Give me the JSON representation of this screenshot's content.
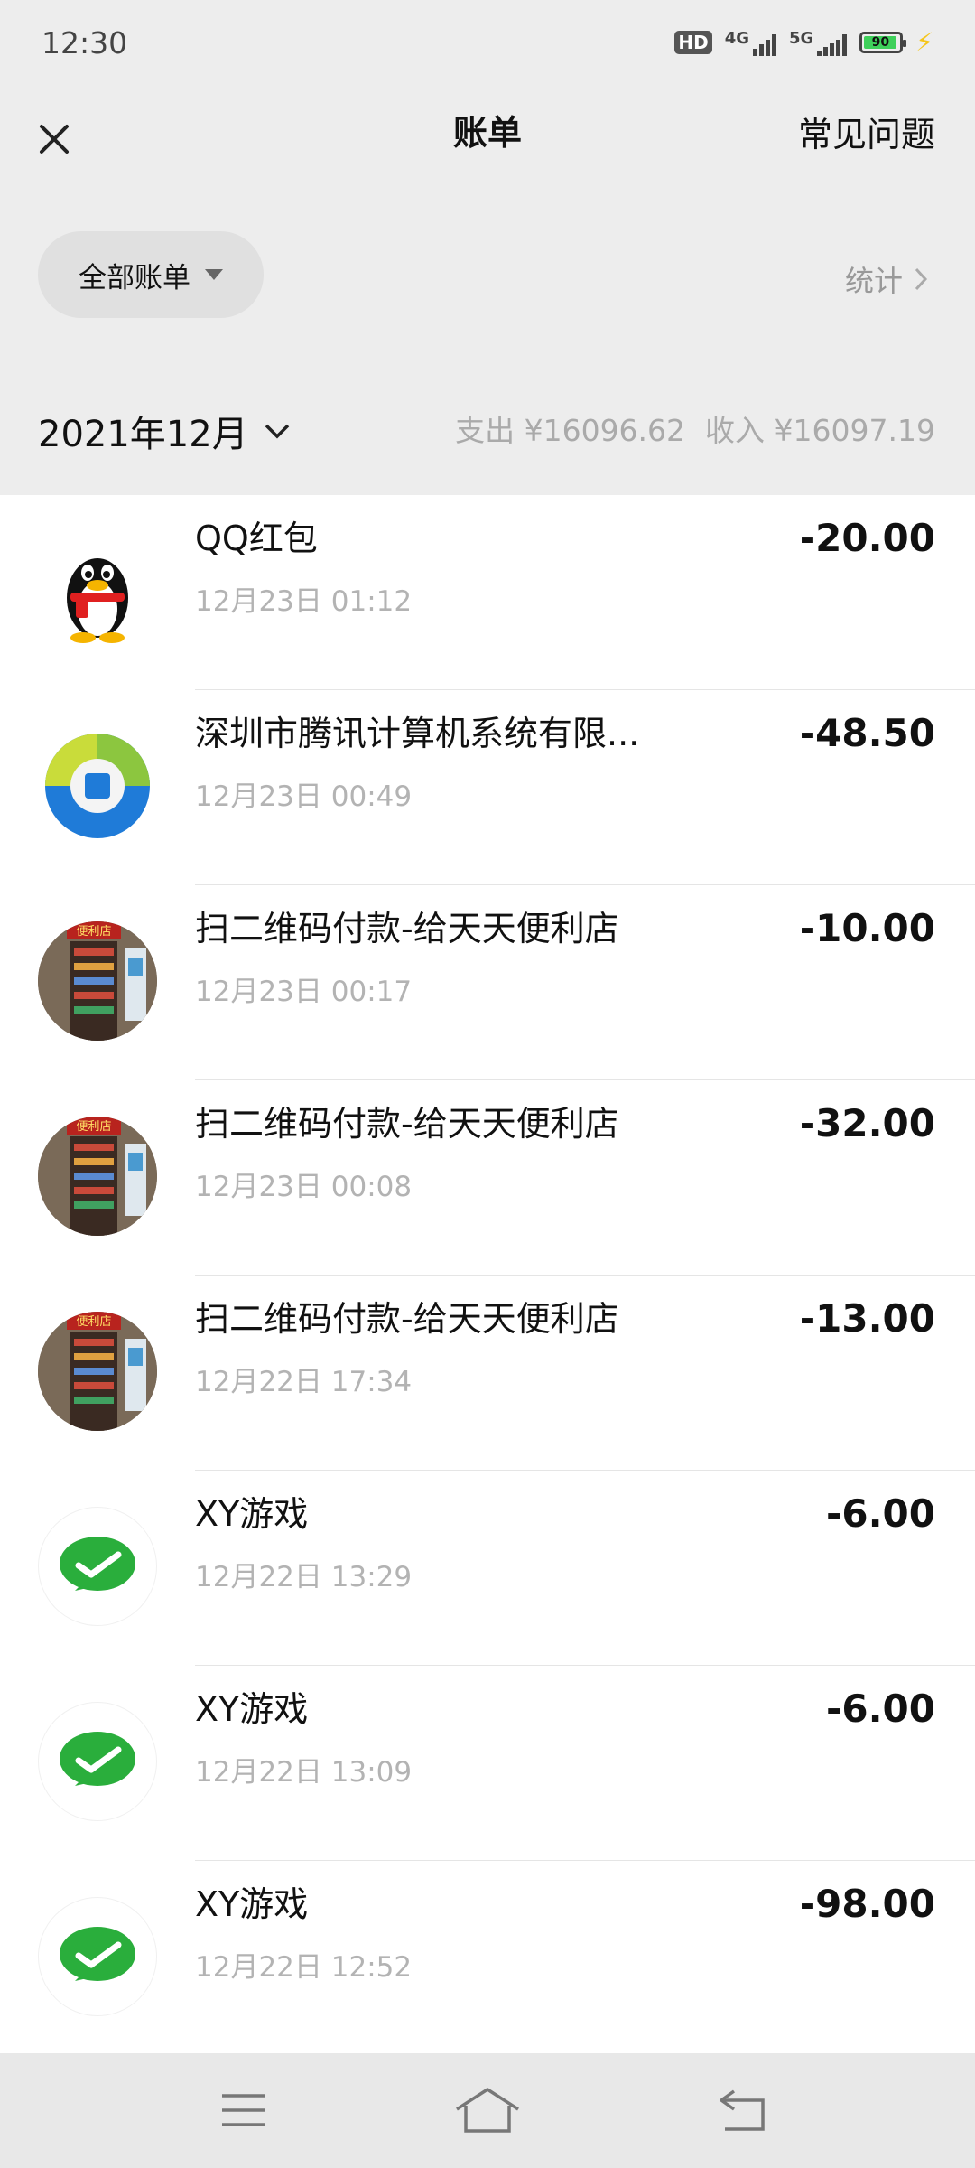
{
  "status_bar": {
    "time": "12:30",
    "hd_label": "HD",
    "network_1": "4G",
    "network_2": "5G",
    "battery_level": "90"
  },
  "nav": {
    "title": "账单",
    "faq_label": "常见问题"
  },
  "filter": {
    "label": "全部账单",
    "stats_label": "统计"
  },
  "month": {
    "label": "2021年12月",
    "expense": "支出 ¥16096.62",
    "income": "收入 ¥16097.19"
  },
  "transactions": [
    {
      "name": "QQ红包",
      "time": "12月23日 01:12",
      "amount": "-20.00",
      "icon": "qq-penguin-icon"
    },
    {
      "name": "深圳市腾讯计算机系统有限...",
      "time": "12月23日 00:49",
      "amount": "-48.50",
      "icon": "tencent-logo-icon"
    },
    {
      "name": "扫二维码付款-给天天便利店",
      "time": "12月23日 00:17",
      "amount": "-10.00",
      "icon": "store-photo"
    },
    {
      "name": "扫二维码付款-给天天便利店",
      "time": "12月23日 00:08",
      "amount": "-32.00",
      "icon": "store-photo"
    },
    {
      "name": "扫二维码付款-给天天便利店",
      "time": "12月22日 17:34",
      "amount": "-13.00",
      "icon": "store-photo"
    },
    {
      "name": "XY游戏",
      "time": "12月22日 13:29",
      "amount": "-6.00",
      "icon": "wechat-pay-icon"
    },
    {
      "name": "XY游戏",
      "time": "12月22日 13:09",
      "amount": "-6.00",
      "icon": "wechat-pay-icon"
    },
    {
      "name": "XY游戏",
      "time": "12月22日 12:52",
      "amount": "-98.00",
      "icon": "wechat-pay-icon"
    }
  ],
  "store_sign": "便利店",
  "colors": {
    "background": "#ededed",
    "list_background": "#ffffff",
    "wechat_green": "#2aae3c",
    "muted_text": "#b3b3b3"
  }
}
